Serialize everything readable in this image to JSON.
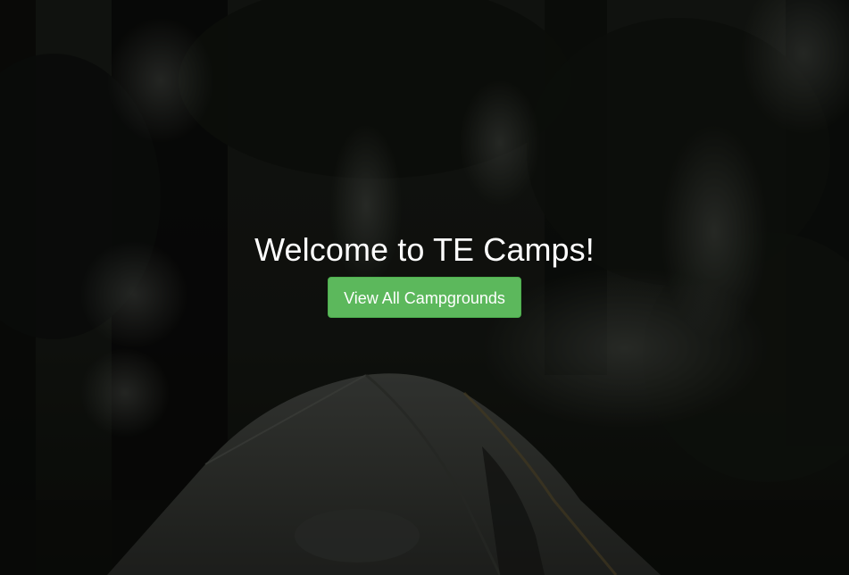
{
  "hero": {
    "title": "Welcome to TE Camps!",
    "button_label": "View All Campgrounds"
  },
  "background": {
    "description_icon": "forest-tent-photo",
    "overlay_color": "#000000"
  },
  "colors": {
    "button_bg": "#5cb85c",
    "button_border": "#4cae4c",
    "title_text": "#ffffff"
  }
}
